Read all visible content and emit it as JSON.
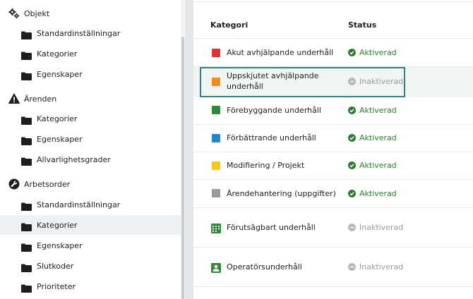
{
  "sidebar": {
    "sections": [
      {
        "label": "Objekt",
        "icon": "gears-icon",
        "items": [
          {
            "label": "Standardinställningar"
          },
          {
            "label": "Kategorier"
          },
          {
            "label": "Egenskaper"
          }
        ]
      },
      {
        "label": "Ärenden",
        "icon": "warning-icon",
        "items": [
          {
            "label": "Kategorier"
          },
          {
            "label": "Egenskaper"
          },
          {
            "label": "Allvarlighetsgrader"
          }
        ]
      },
      {
        "label": "Arbetsorder",
        "icon": "wrench-icon",
        "items": [
          {
            "label": "Standardinställningar"
          },
          {
            "label": "Kategorier",
            "active": true
          },
          {
            "label": "Egenskaper"
          },
          {
            "label": "Slutkoder"
          },
          {
            "label": "Prioriteter"
          }
        ]
      }
    ]
  },
  "table": {
    "headers": {
      "category": "Kategori",
      "status": "Status"
    },
    "rows": [
      {
        "label": "Akut avhjälpande underhåll",
        "color": "#d93636",
        "status": "Aktiverad",
        "active": true
      },
      {
        "label": "Uppskjutet avhjälpande underhåll",
        "color": "#f28c1c",
        "status": "Inaktiverad",
        "active": false
      },
      {
        "label": "Förebyggande underhåll",
        "color": "#2e8b3a",
        "status": "Aktiverad",
        "active": true
      },
      {
        "label": "Förbättrande underhåll",
        "color": "#1f86d0",
        "status": "Aktiverad",
        "active": true
      },
      {
        "label": "Modifiering / Projekt",
        "color": "#f6c81e",
        "status": "Aktiverad",
        "active": true
      },
      {
        "label": "Ärendehantering (uppgifter)",
        "color": "#9a9a9a",
        "status": "Aktiverad",
        "active": true
      },
      {
        "label": "Förutsägbart underhåll",
        "icon": "calendar-grid-icon",
        "color": "#2e8b3a",
        "status": "Inaktiverad",
        "active": false
      },
      {
        "label": "Operatörsunderhåll",
        "icon": "operator-card-icon",
        "color": "#2e8b3a",
        "status": "Inaktiverad",
        "active": false
      }
    ]
  }
}
